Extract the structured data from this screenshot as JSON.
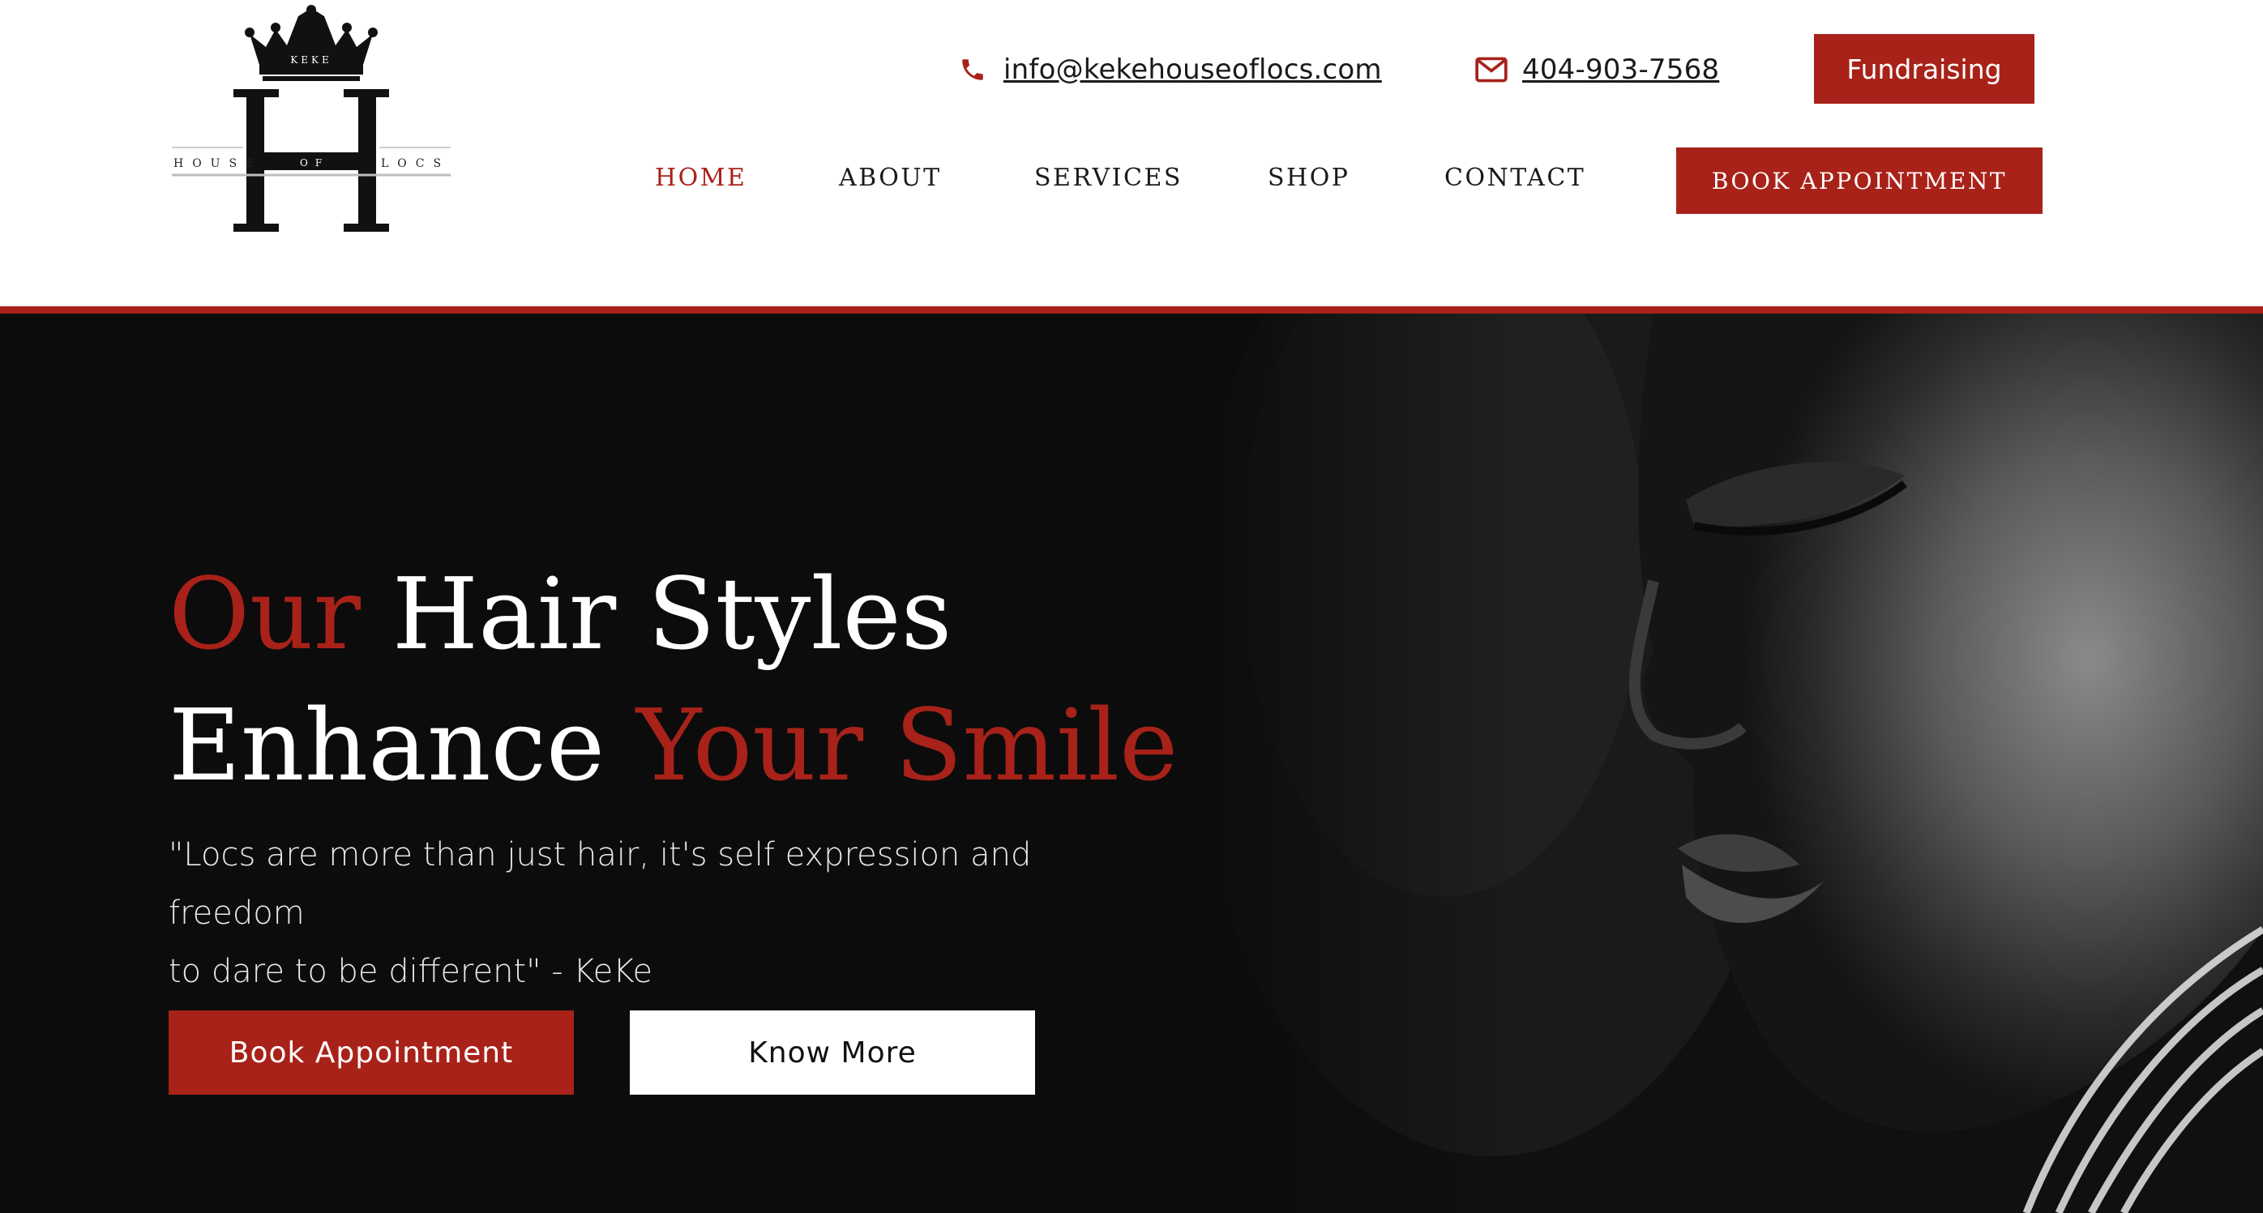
{
  "brand": {
    "name": "KeKe House of Locs",
    "logo_monogram": "H",
    "logo_crown_text": "KEKE",
    "logo_left_text": "HOUSE",
    "logo_center_text": "OF",
    "logo_right_text": "LOCS"
  },
  "contact": {
    "email": "info@kekehouseoflocs.com",
    "phone": "404-903-7568",
    "email_icon": "phone-icon",
    "phone_icon": "envelope-icon"
  },
  "header": {
    "fundraising_label": "Fundraising"
  },
  "nav": {
    "items": [
      {
        "label": "HOME",
        "active": true
      },
      {
        "label": "ABOUT",
        "active": false
      },
      {
        "label": "SERVICES",
        "active": false
      },
      {
        "label": "SHOP",
        "active": false
      },
      {
        "label": "CONTACT",
        "active": false
      }
    ],
    "book_label": "BOOK APPOINTMENT"
  },
  "hero": {
    "headline_line1_red": "Our",
    "headline_line1_white": " Hair Styles",
    "headline_line2_white": "Enhance ",
    "headline_line2_red": "Your Smile",
    "quote_line1": "\"Locs are more than just hair, it's self expression and freedom",
    "quote_line2": "to dare to be different\" - KeKe",
    "primary_button": "Book Appointment",
    "secondary_button": "Know More"
  },
  "colors": {
    "accent": "#a82219",
    "hero_background": "#0c0c0c",
    "text_dark": "#1a1a1a",
    "white": "#ffffff"
  }
}
